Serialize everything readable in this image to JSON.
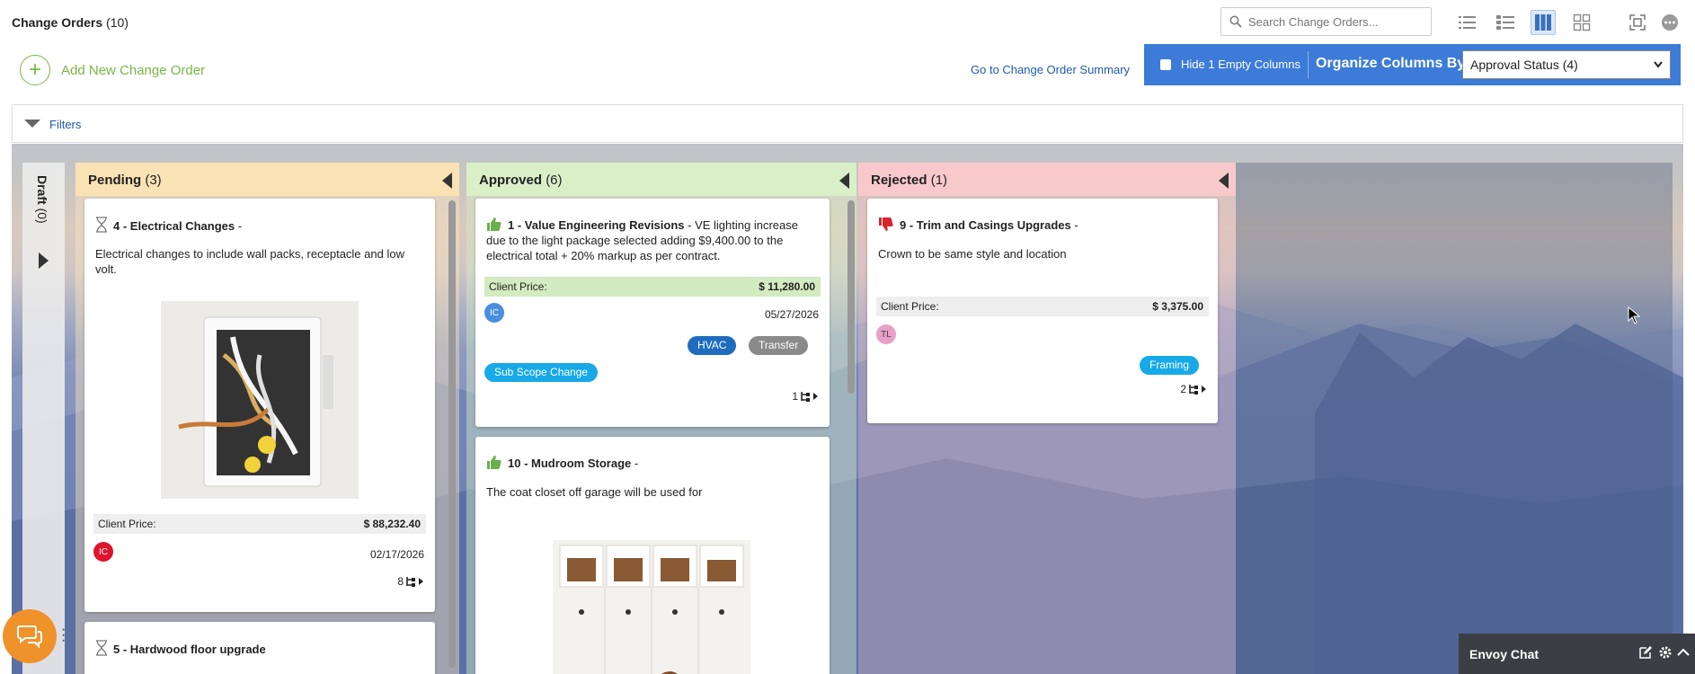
{
  "header": {
    "title": "Change Orders",
    "title_count": "(10)",
    "search_placeholder": "Search Change Orders..."
  },
  "view_buttons": [
    {
      "name": "list-view-icon"
    },
    {
      "name": "compact-list-view-icon"
    },
    {
      "name": "board-view-icon",
      "active": true
    },
    {
      "name": "grid-view-icon"
    },
    {
      "name": "expand-screen-icon"
    },
    {
      "name": "more-options-icon"
    }
  ],
  "actions": {
    "add_label": "Add New Change Order",
    "summary_link": "Go to Change Order Summary",
    "hide_empty_label": "Hide 1 Empty Columns",
    "organize_label": "Organize Columns By",
    "organize_value": "Approval Status (4)"
  },
  "filters": {
    "label": "Filters"
  },
  "colors": {
    "accent_green": "#7ab648",
    "panel_blue": "#3d7bd8",
    "pending_header": "#fbe2b4",
    "approved_header": "#d9efc8",
    "rejected_header": "#f8c9cb"
  },
  "columns": {
    "draft": {
      "title": "Draft",
      "count": "(0)"
    },
    "pending": {
      "title": "Pending",
      "count": "(3)",
      "cards": [
        {
          "status_icon": "hourglass-icon",
          "title": "4 - Electrical Changes",
          "suffix": " -",
          "description": "Electrical changes to include wall packs, receptacle and low volt.",
          "price_label": "Client Price:",
          "price": "$ 88,232.40",
          "avatar": "IC",
          "avatar_color": "#e0142c",
          "date": "02/17/2026",
          "sub_count": "8"
        },
        {
          "status_icon": "hourglass-icon",
          "title": "5 - Hardwood floor upgrade"
        }
      ]
    },
    "approved": {
      "title": "Approved",
      "count": "(6)",
      "cards": [
        {
          "status_icon": "thumbs-up-icon",
          "title": "1 - Value Engineering Revisions",
          "suffix": " - VE lighting increase due to the light package selected adding $9,400.00 to the electrical total + 20% markup as per contract.",
          "price_label": "Client Price:",
          "price": "$ 11,280.00",
          "avatar": "IC",
          "avatar_color": "#4a8ee0",
          "date": "05/27/2026",
          "tags": [
            "HVAC",
            "Transfer"
          ],
          "tag2": "Sub Scope Change",
          "sub_count": "1"
        },
        {
          "status_icon": "thumbs-up-icon",
          "title": "10 - Mudroom Storage",
          "suffix": " -",
          "description": "The coat closet off garage will be used for"
        }
      ]
    },
    "rejected": {
      "title": "Rejected",
      "count": "(1)",
      "cards": [
        {
          "status_icon": "thumbs-down-icon",
          "title": "9 - Trim and Casings Upgrades",
          "suffix": " -",
          "description": "Crown to be same style and location",
          "price_label": "Client Price:",
          "price": "$ 3,375.00",
          "avatar": "TL",
          "avatar_color": "#e8a0c8",
          "tags": [
            "Framing"
          ],
          "sub_count": "2"
        }
      ]
    }
  },
  "chat": {
    "title": "Envoy Chat"
  }
}
